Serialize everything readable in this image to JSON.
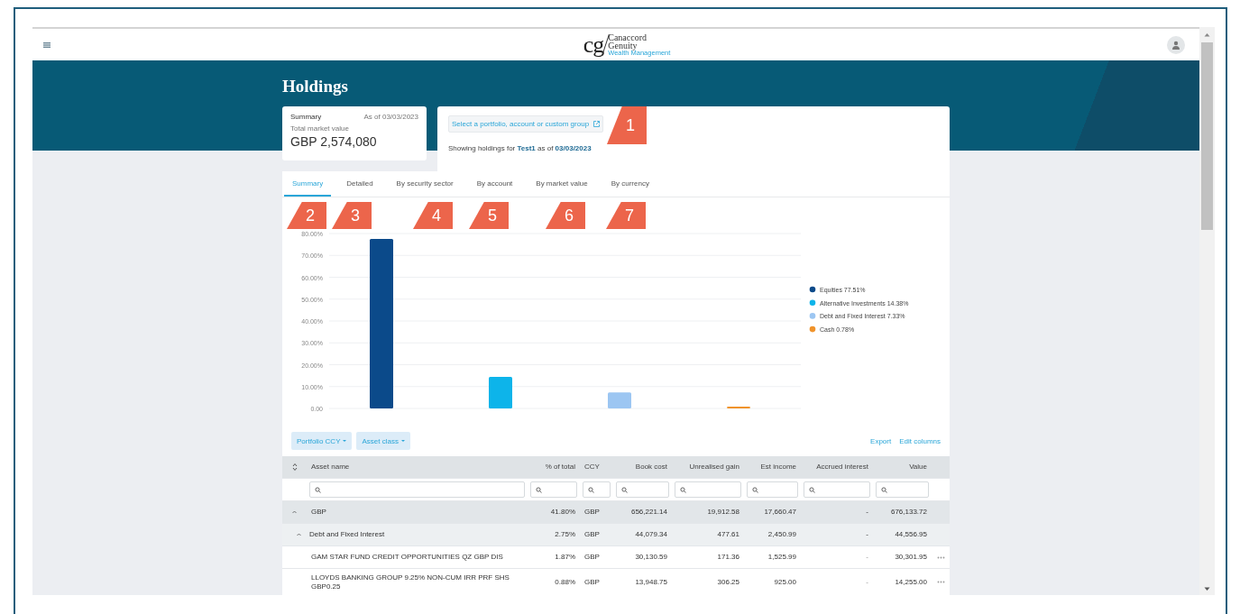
{
  "logo": {
    "mark": "cg",
    "line_1": "Canaccord",
    "line_2": "Genuity",
    "tagline": "Wealth Management"
  },
  "page_title": "Holdings",
  "summary_card": {
    "title": "Summary",
    "as_of": "As of 03/03/2023",
    "label": "Total market value",
    "value": "GBP 2,574,080"
  },
  "selector": {
    "button": "Select a portfolio, account or custom group",
    "showing": "Showing holdings for **Test1** as of **03/03/2023**"
  },
  "tabs": [
    {
      "label": "Summary",
      "selected": true
    },
    {
      "label": "Detailed",
      "selected": false
    },
    {
      "label": "By security sector",
      "selected": false
    },
    {
      "label": "By account",
      "selected": false
    },
    {
      "label": "By market value",
      "selected": false
    },
    {
      "label": "By currency",
      "selected": false
    }
  ],
  "callouts": [
    "1",
    "2",
    "3",
    "4",
    "5",
    "6",
    "7"
  ],
  "chart_data": {
    "type": "bar",
    "grid": true,
    "series": [
      {
        "values": [
          77.5,
          14.4,
          7.3,
          0.8
        ]
      }
    ],
    "ylim": [
      0,
      80
    ],
    "yticks": [
      {
        "value": 0,
        "label": "0.00"
      },
      {
        "value": 10,
        "label": "10.00%"
      },
      {
        "value": 20,
        "label": "20.00%"
      },
      {
        "value": 30,
        "label": "30.00%"
      },
      {
        "value": 40,
        "label": "40.00%"
      },
      {
        "value": 50,
        "label": "50.00%"
      },
      {
        "value": 60,
        "label": "60.00%"
      },
      {
        "value": 70,
        "label": "70.00%"
      },
      {
        "value": 80,
        "label": "80.00%"
      }
    ]
  },
  "legend": [
    {
      "label": "Equities 77.51%",
      "color": "#0b4a8a"
    },
    {
      "label": "Alternative Investments 14.38%",
      "color": "#0db4ea"
    },
    {
      "label": "Debt and Fixed Interest 7.33%",
      "color": "#9cc6f2"
    },
    {
      "label": "Cash 0.78%",
      "color": "#f0932b"
    }
  ],
  "filters": [
    "Portfolio CCY",
    "Asset class"
  ],
  "actions": [
    "Export",
    "Edit columns"
  ],
  "columns": [
    "Asset name",
    "% of total",
    "CCY",
    "Book cost",
    "Unrealised gain",
    "Est income",
    "Accrued interest",
    "Value"
  ],
  "rows": [
    {
      "kind": "group",
      "expanded": true,
      "cells": [
        "GBP",
        "41.80%",
        "GBP",
        "656,221.14",
        "19,912.58",
        "17,660.47",
        "-",
        "676,133.72"
      ]
    },
    {
      "kind": "subgroup",
      "expanded": true,
      "cells": [
        "Debt and Fixed Interest",
        "2.75%",
        "GBP",
        "44,079.34",
        "477.61",
        "2,450.99",
        "-",
        "44,556.95"
      ]
    },
    {
      "kind": "holding",
      "cells": [
        "GAM STAR FUND CREDIT OPPORTUNITIES QZ GBP DIS",
        "1.87%",
        "GBP",
        "30,130.59",
        "171.36",
        "1,525.99",
        "-",
        "30,301.95"
      ]
    },
    {
      "kind": "holding",
      "cells": [
        "LLOYDS BANKING GROUP 9.25% NON-CUM IRR PRF SHS GBP0.25",
        "0.88%",
        "GBP",
        "13,948.75",
        "306.25",
        "925.00",
        "-",
        "14,255.00"
      ]
    }
  ]
}
